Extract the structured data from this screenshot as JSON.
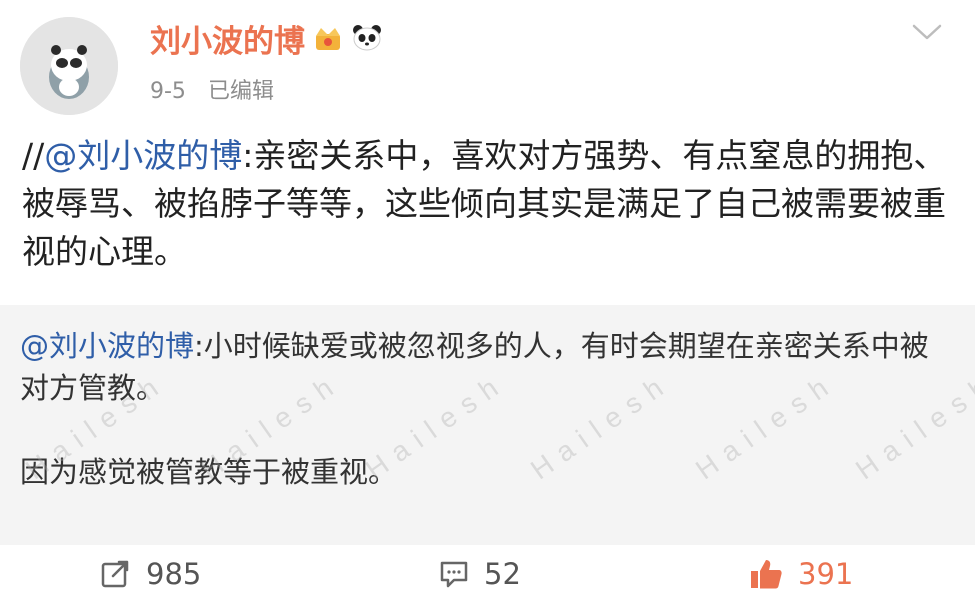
{
  "post": {
    "author": "刘小波的博",
    "date": "9-5",
    "edited_label": "已编辑",
    "body_prefix": "//",
    "body_mention": "@刘小波的博",
    "body_text": ":亲密关系中，喜欢对方强势、有点窒息的拥抱、被辱骂、被掐脖子等等，这些倾向其实是满足了自己被需要被重视的心理。"
  },
  "quote": {
    "mention": "@刘小波的博",
    "line1": ":小时候缺爱或被忽视多的人，有时会期望在亲密关系中被对方管教。",
    "line2": "因为感觉被管教等于被重视。"
  },
  "watermark": "Hailesh",
  "actions": {
    "repost_count": "985",
    "comment_count": "52",
    "like_count": "391"
  },
  "colors": {
    "author": "#eb7350",
    "mention": "#2f5ea8",
    "like": "#eb7350",
    "quote_bg": "#f4f4f4"
  },
  "icons": [
    "panda-avatar",
    "crown-badge-icon",
    "panda-icon",
    "chevron-down-icon",
    "repost-icon",
    "comment-icon",
    "like-icon"
  ]
}
